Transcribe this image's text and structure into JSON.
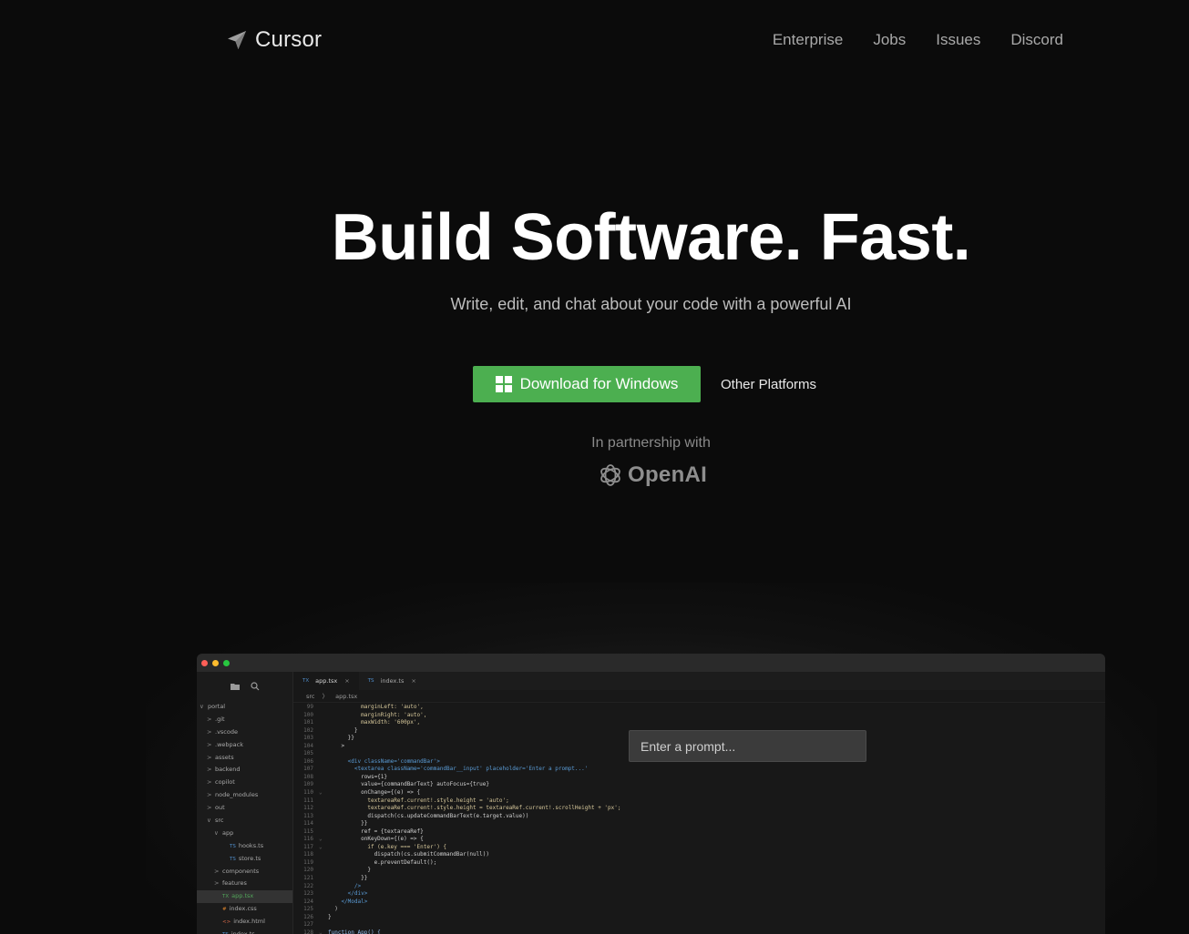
{
  "nav": {
    "brand": "Cursor",
    "links": [
      "Enterprise",
      "Jobs",
      "Issues",
      "Discord"
    ]
  },
  "hero": {
    "title": "Build Software. Fast.",
    "subtitle": "Write, edit, and chat about your code with a powerful AI",
    "download_label": "Download for Windows",
    "other_platforms_label": "Other Platforms",
    "partnership": "In partnership with",
    "partner_name": "OpenAI"
  },
  "colors": {
    "background": "#0b0b0b",
    "download_button": "#4caf50",
    "dot_red": "#ff5f57",
    "dot_yellow": "#febc2e",
    "dot_green": "#28c840"
  },
  "editor": {
    "tabs": [
      {
        "badge": "TX",
        "name": "app.tsx",
        "close": "×"
      },
      {
        "badge": "TS",
        "name": "index.ts",
        "close": "×"
      }
    ],
    "breadcrumb": [
      "src",
      "〉",
      "app.tsx"
    ],
    "tree": [
      {
        "chev": "∨",
        "icon": "",
        "label": "portal",
        "indent": 0
      },
      {
        "chev": ">",
        "icon": "",
        "label": ".git",
        "indent": 1
      },
      {
        "chev": ">",
        "icon": "",
        "label": ".vscode",
        "indent": 1
      },
      {
        "chev": ">",
        "icon": "",
        "label": ".webpack",
        "indent": 1
      },
      {
        "chev": ">",
        "icon": "",
        "label": "assets",
        "indent": 1
      },
      {
        "chev": ">",
        "icon": "",
        "label": "backend",
        "indent": 1
      },
      {
        "chev": ">",
        "icon": "",
        "label": "copilot",
        "indent": 1
      },
      {
        "chev": ">",
        "icon": "",
        "label": "node_modules",
        "indent": 1
      },
      {
        "chev": ">",
        "icon": "",
        "label": "out",
        "indent": 1
      },
      {
        "chev": "∨",
        "icon": "",
        "label": "src",
        "indent": 1
      },
      {
        "chev": "∨",
        "icon": "",
        "label": "app",
        "indent": 2
      },
      {
        "chev": "",
        "icon": "TS",
        "label": "hooks.ts",
        "indent": 3
      },
      {
        "chev": "",
        "icon": "TS",
        "label": "store.ts",
        "indent": 3
      },
      {
        "chev": ">",
        "icon": "",
        "label": "components",
        "indent": 2
      },
      {
        "chev": ">",
        "icon": "",
        "label": "features",
        "indent": 2
      },
      {
        "chev": "",
        "icon": "TX",
        "label": "app.tsx",
        "indent": 2,
        "active": true
      },
      {
        "chev": "",
        "icon": "#",
        "label": "index.css",
        "indent": 2
      },
      {
        "chev": "",
        "icon": "<>",
        "label": "index.html",
        "indent": 2
      },
      {
        "chev": "",
        "icon": "TS",
        "label": "index.ts",
        "indent": 2
      }
    ],
    "code": [
      {
        "n": "99",
        "f": "",
        "t": "          marginLeft: 'auto',"
      },
      {
        "n": "100",
        "f": "",
        "t": "          marginRight: 'auto',"
      },
      {
        "n": "101",
        "f": "",
        "t": "          maxWidth: '600px',"
      },
      {
        "n": "102",
        "f": "",
        "t": "        }"
      },
      {
        "n": "103",
        "f": "",
        "t": "      }}"
      },
      {
        "n": "104",
        "f": "",
        "t": "    >"
      },
      {
        "n": "105",
        "f": "",
        "t": ""
      },
      {
        "n": "106",
        "f": "",
        "t": "      <div className='commandBar'>"
      },
      {
        "n": "107",
        "f": "",
        "t": "        <textarea className='commandBar__input' placeholder='Enter a prompt...'"
      },
      {
        "n": "108",
        "f": "",
        "t": "          rows={1}"
      },
      {
        "n": "109",
        "f": "",
        "t": "          value={commandBarText} autoFocus={true}"
      },
      {
        "n": "110",
        "f": "⌄",
        "t": "          onChange={(e) => {"
      },
      {
        "n": "111",
        "f": "",
        "t": "            textareaRef.current!.style.height = 'auto';"
      },
      {
        "n": "112",
        "f": "",
        "t": "            textareaRef.current!.style.height = textareaRef.current!.scrollHeight + 'px';"
      },
      {
        "n": "113",
        "f": "",
        "t": "            dispatch(cs.updateCommandBarText(e.target.value))"
      },
      {
        "n": "114",
        "f": "",
        "t": "          }}"
      },
      {
        "n": "115",
        "f": "",
        "t": "          ref = {textareaRef}"
      },
      {
        "n": "116",
        "f": "⌄",
        "t": "          onKeyDown={(e) => {"
      },
      {
        "n": "117",
        "f": "⌄",
        "t": "            if (e.key === 'Enter') {"
      },
      {
        "n": "118",
        "f": "",
        "t": "              dispatch(cs.submitCommandBar(null))"
      },
      {
        "n": "119",
        "f": "",
        "t": "              e.preventDefault();"
      },
      {
        "n": "120",
        "f": "",
        "t": "            }"
      },
      {
        "n": "121",
        "f": "",
        "t": "          }}"
      },
      {
        "n": "122",
        "f": "",
        "t": "        />"
      },
      {
        "n": "123",
        "f": "",
        "t": "      </div>"
      },
      {
        "n": "124",
        "f": "",
        "t": "    </Modal>"
      },
      {
        "n": "125",
        "f": "",
        "t": "  )"
      },
      {
        "n": "126",
        "f": "",
        "t": "}"
      },
      {
        "n": "127",
        "f": "",
        "t": ""
      },
      {
        "n": "128",
        "f": "⌄",
        "t": "function App() {"
      }
    ],
    "prompt_placeholder": "Enter a prompt..."
  }
}
